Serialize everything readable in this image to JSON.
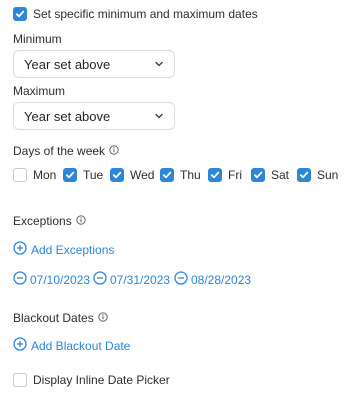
{
  "specific_dates": {
    "label": "Set specific minimum and maximum dates",
    "checked": true
  },
  "minimum": {
    "label": "Minimum",
    "value": "Year set above"
  },
  "maximum": {
    "label": "Maximum",
    "value": "Year set above"
  },
  "days": {
    "label": "Days of the week",
    "items": [
      {
        "label": "Mon",
        "checked": false
      },
      {
        "label": "Tue",
        "checked": true
      },
      {
        "label": "Wed",
        "checked": true
      },
      {
        "label": "Thu",
        "checked": true
      },
      {
        "label": "Fri",
        "checked": true
      },
      {
        "label": "Sat",
        "checked": true
      },
      {
        "label": "Sun",
        "checked": true
      }
    ]
  },
  "exceptions": {
    "label": "Exceptions",
    "add_label": "Add Exceptions",
    "dates": [
      "07/10/2023",
      "07/31/2023",
      "08/28/2023"
    ]
  },
  "blackout": {
    "label": "Blackout Dates",
    "add_label": "Add Blackout Date"
  },
  "inline_picker": {
    "label": "Display Inline Date Picker",
    "checked": false
  },
  "colors": {
    "accent": "#2e86d6",
    "text": "#2a2e35",
    "border": "#d9dde2"
  }
}
